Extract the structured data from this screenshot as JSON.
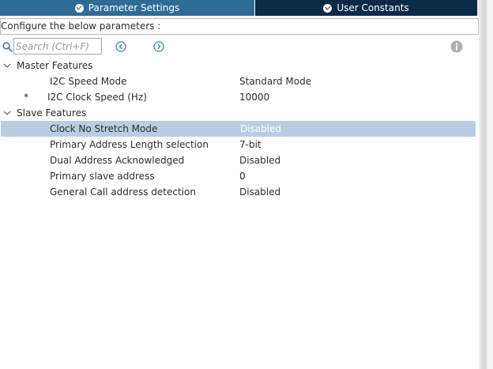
{
  "tabs": [
    {
      "label": "Parameter Settings",
      "icon": "check-circle-icon",
      "active": true
    },
    {
      "label": "User Constants",
      "icon": "check-circle-icon",
      "active": false
    }
  ],
  "configure_label": "Configure the below parameters :",
  "search": {
    "placeholder": "Search (Ctrl+F)",
    "value": ""
  },
  "groups": [
    {
      "label": "Master Features",
      "items": [
        {
          "name": "I2C Speed Mode",
          "value": "Standard Mode",
          "marker": ""
        },
        {
          "name": "I2C Clock Speed (Hz)",
          "value": "10000",
          "marker": "*"
        }
      ]
    },
    {
      "label": "Slave Features",
      "items": [
        {
          "name": "Clock No Stretch Mode",
          "value": "Disabled",
          "marker": "",
          "selected": true
        },
        {
          "name": "Primary Address Length selection",
          "value": "7-bit",
          "marker": ""
        },
        {
          "name": "Dual Address Acknowledged",
          "value": "Disabled",
          "marker": ""
        },
        {
          "name": "Primary slave address",
          "value": "0",
          "marker": ""
        },
        {
          "name": "General Call address detection",
          "value": "Disabled",
          "marker": ""
        }
      ]
    }
  ],
  "colors": {
    "tab_active": "#2f6b97",
    "tab_inactive": "#0a2a48",
    "selection": "#b8cde2",
    "accent_icon": "#2f7fc1"
  }
}
